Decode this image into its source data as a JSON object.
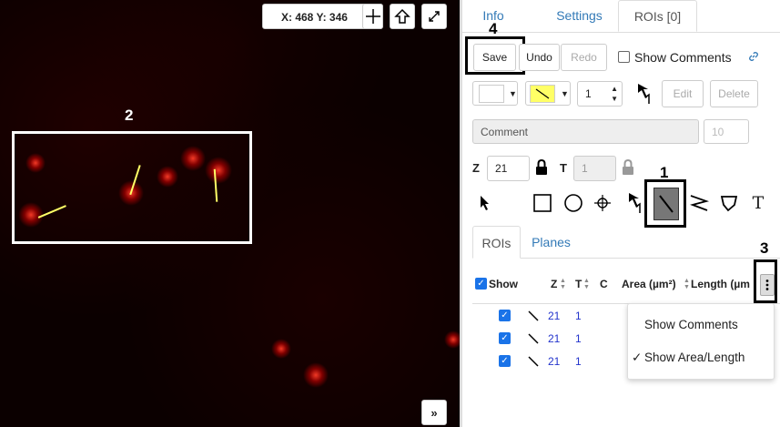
{
  "viewer": {
    "coord_text": "X: 468 Y: 346",
    "expand_icon": "»",
    "annotation_2": "2"
  },
  "tabs": [
    {
      "label": "Info"
    },
    {
      "label": "Settings"
    },
    {
      "label": "ROIs [0]"
    }
  ],
  "toolbar": {
    "save_label": "Save",
    "undo_label": "Undo",
    "redo_label": "Redo",
    "show_comments_label": "Show Comments",
    "stroke_width": "1",
    "edit_label": "Edit",
    "delete_label": "Delete",
    "annotation_4": "4"
  },
  "comment": {
    "placeholder": "Comment",
    "font_size": "10"
  },
  "zt": {
    "z_label": "Z",
    "z_value": "21",
    "t_label": "T",
    "t_value": "1"
  },
  "tools": {
    "text_tool": "T",
    "annotation_1": "1"
  },
  "subtabs": [
    {
      "label": "ROIs"
    },
    {
      "label": "Planes"
    }
  ],
  "table": {
    "headers": {
      "show": "Show",
      "z": "Z",
      "t": "T",
      "c": "C",
      "area": "Area (µm²)",
      "length": "Length (µm"
    },
    "rows": [
      {
        "z": "21",
        "t": "1"
      },
      {
        "z": "21",
        "t": "1"
      },
      {
        "z": "21",
        "t": "1"
      }
    ],
    "annotation_3": "3"
  },
  "menu": {
    "items": [
      {
        "label": "Show Comments",
        "checked": ""
      },
      {
        "label": "Show Area/Length",
        "checked": "✓"
      }
    ]
  }
}
